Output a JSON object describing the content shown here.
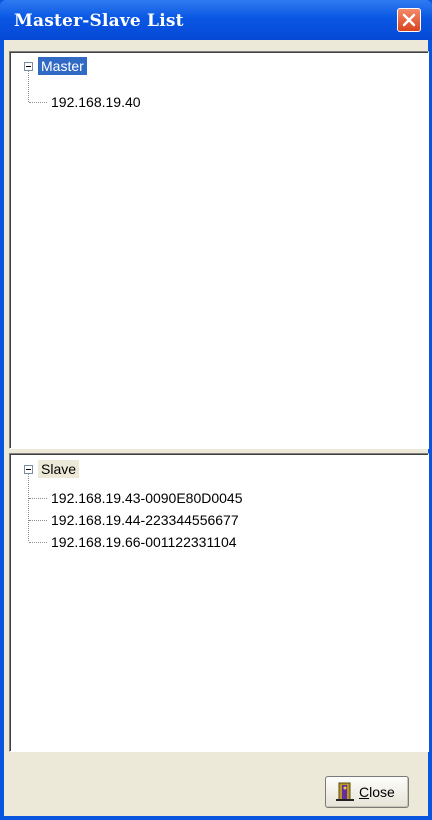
{
  "window": {
    "title": "Master-Slave List",
    "close_icon": "close-x-icon"
  },
  "master_tree": {
    "root_label": "Master",
    "children": [
      "192.168.19.40"
    ]
  },
  "slave_tree": {
    "root_label": "Slave",
    "children": [
      "192.168.19.43-0090E80D0045",
      "192.168.19.44-223344556677",
      "192.168.19.66-001122331104"
    ]
  },
  "footer": {
    "close_button_label": "Close",
    "close_button_icon": "door-exit-icon"
  },
  "colors": {
    "title_bar": "#0a55e0",
    "selection": "#316ac5",
    "window_bg": "#ece9d8",
    "close_red": "#d9431e"
  }
}
